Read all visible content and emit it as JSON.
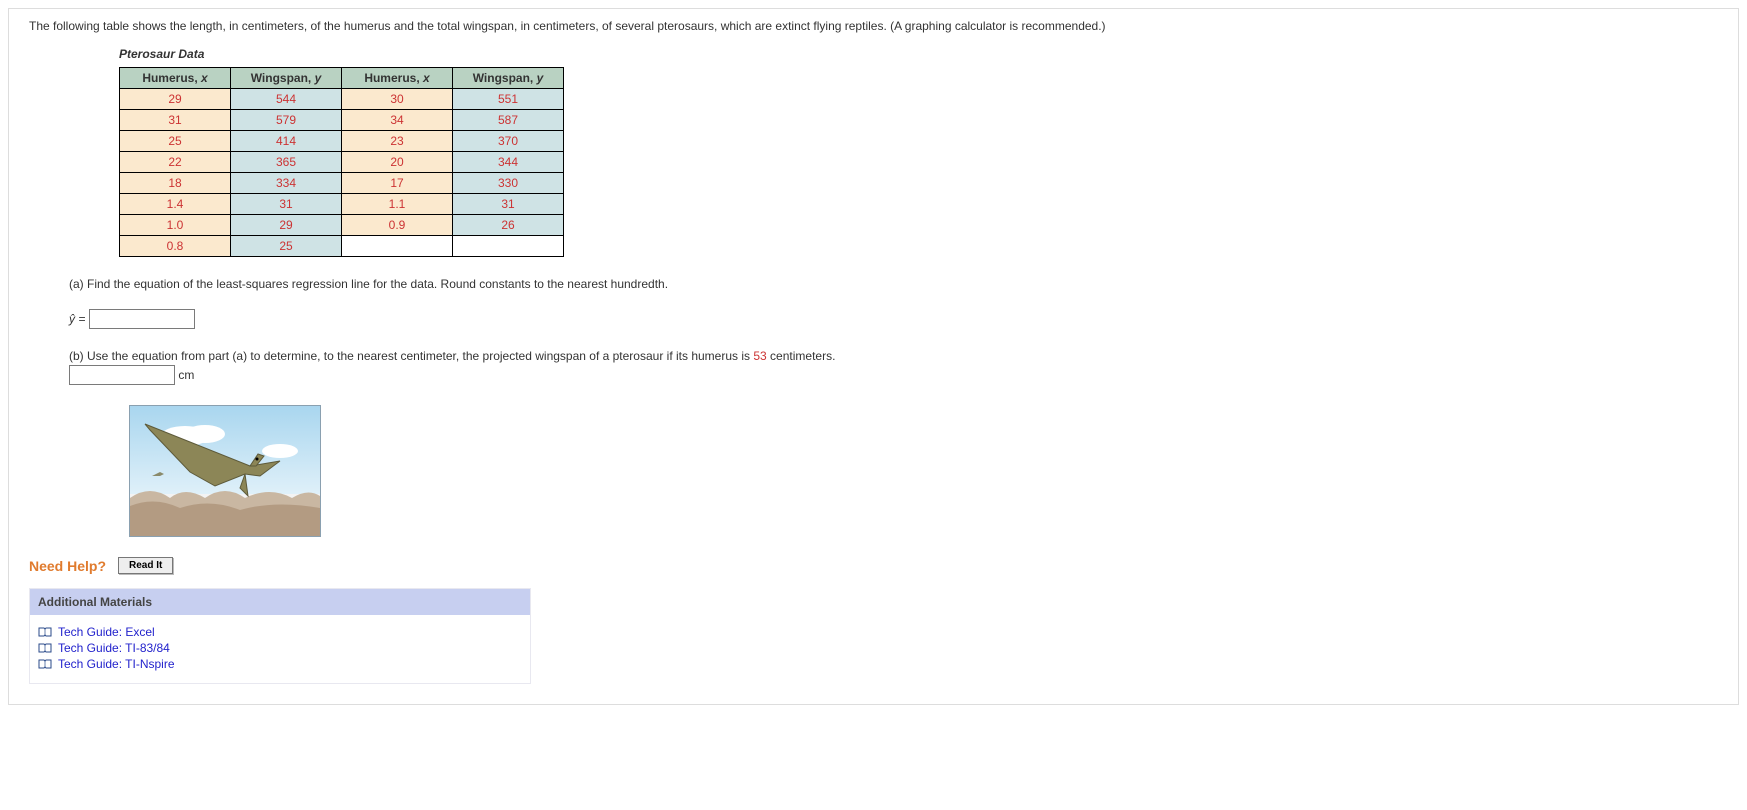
{
  "intro": "The following table shows the length, in centimeters, of the humerus and the total wingspan, in centimeters, of several pterosaurs, which are extinct flying reptiles. (A graphing calculator is recommended.)",
  "table_title": "Pterosaur Data",
  "headers": {
    "hx_label": "Humerus, ",
    "hx_var": "x",
    "wy_label": "Wingspan, ",
    "wy_var": "y"
  },
  "rows": [
    {
      "x1": "29",
      "y1": "544",
      "x2": "30",
      "y2": "551"
    },
    {
      "x1": "31",
      "y1": "579",
      "x2": "34",
      "y2": "587"
    },
    {
      "x1": "25",
      "y1": "414",
      "x2": "23",
      "y2": "370"
    },
    {
      "x1": "22",
      "y1": "365",
      "x2": "20",
      "y2": "344"
    },
    {
      "x1": "18",
      "y1": "334",
      "x2": "17",
      "y2": "330"
    },
    {
      "x1": "1.4",
      "y1": "31",
      "x2": "1.1",
      "y2": "31"
    },
    {
      "x1": "1.0",
      "y1": "29",
      "x2": "0.9",
      "y2": "26"
    },
    {
      "x1": "0.8",
      "y1": "25",
      "x2": "",
      "y2": ""
    }
  ],
  "part_a": {
    "text": "(a) Find the equation of the least-squares regression line for the data. Round constants to the nearest hundredth.",
    "eq_prefix": "ŷ ="
  },
  "part_b": {
    "prefix": "(b) Use the equation from part (a) to determine, to the nearest centimeter, the projected wingspan of a pterosaur if its humerus is ",
    "value": "53",
    "suffix": " centimeters.",
    "unit": "cm"
  },
  "help": {
    "label": "Need Help?",
    "read_it": "Read It"
  },
  "additional": {
    "header": "Additional Materials",
    "links": [
      "Tech Guide: Excel",
      "Tech Guide: TI-83/84",
      "Tech Guide: TI-Nspire"
    ]
  }
}
